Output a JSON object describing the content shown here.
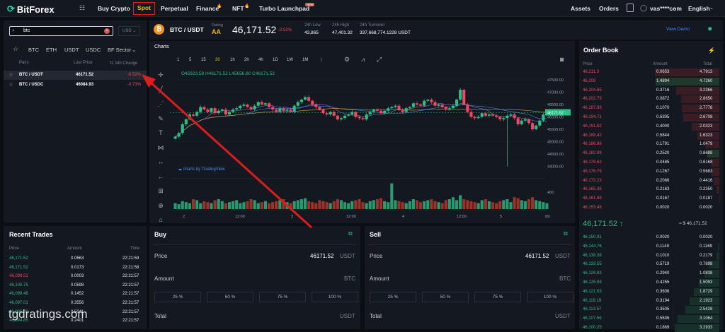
{
  "nav": {
    "logo": "BitForex",
    "items": [
      "Buy Crypto",
      "Spot",
      "Perpetual",
      "Finance",
      "NFT",
      "Turbo Launchpad"
    ],
    "new_badge": "NEW",
    "assets": "Assets",
    "orders": "Orders",
    "account": "vas****com",
    "language": "English"
  },
  "market": {
    "search_value": "btc",
    "currency": "USD",
    "tabs": [
      "BTC",
      "ETH",
      "USDT",
      "USDC",
      "BF Sector"
    ],
    "headers": [
      "Pairs",
      "Last Price",
      "24h Change"
    ],
    "rows": [
      {
        "pair": "BTC / USDT",
        "price": "46171.52",
        "change": "-0.52%"
      },
      {
        "pair": "BTC / USDC",
        "price": "46084.93",
        "change": "-0.73%"
      }
    ]
  },
  "ticker": {
    "pair": "BTC / USDT",
    "rating_label": "Rating",
    "rating": "AA",
    "price": "46,171.52",
    "change": "-0.52%",
    "low_label": "24h Low",
    "low": "43,865",
    "high_label": "24h High",
    "high": "47,401.32",
    "turnover_label": "24h Turnover",
    "turnover": "337,668,774.1228 USDT",
    "view_demo": "View Demo"
  },
  "chart": {
    "title": "Charts",
    "timeframes": [
      "1",
      "5",
      "15",
      "30",
      "1h",
      "2h",
      "4h",
      "1D",
      "1W",
      "1M"
    ],
    "ohlc": {
      "o": "O45923.59",
      "h": "H46171.52",
      "l": "L45656.80",
      "c": "C46171.52"
    },
    "watermark": "charts by TradingView",
    "price_label": "46171.52",
    "y_ticks": [
      "47500.00",
      "47000.00",
      "46500.00",
      "46000.00",
      "45500.00",
      "45000.00",
      "44500.00",
      "44000.00"
    ],
    "vol_tick": "400",
    "x_ticks": [
      "2",
      "12:00",
      "3",
      "12:00",
      "4",
      "12:00",
      "5",
      "09:"
    ]
  },
  "chart_data": {
    "type": "candlestick",
    "ylim": [
      43700,
      47700
    ],
    "close": [
      45200,
      45350,
      45700,
      45900,
      46100,
      46050,
      46200,
      46400,
      46300,
      46200,
      46350,
      46150,
      46250,
      46300,
      46100,
      46200,
      46300,
      46350,
      46450,
      46500,
      46400,
      46300,
      46450,
      46600,
      46500,
      46550,
      46400,
      46300,
      46200,
      46350,
      46250,
      46300,
      46200,
      46450,
      46600,
      46700,
      46800,
      46650,
      46500,
      46400,
      46300,
      46150,
      46100,
      46200,
      46050,
      45900,
      45950,
      46050,
      46100,
      46200,
      46000,
      45950,
      45900,
      46100,
      46200,
      46300,
      46250,
      46150,
      46250,
      46350,
      46400,
      46450,
      46300,
      46200,
      46350,
      46400,
      46550,
      46500,
      46450,
      46650,
      46700,
      46600,
      46450,
      46500,
      46400,
      46300,
      46350,
      46450,
      46700,
      47100,
      46500,
      46200,
      46000,
      45950,
      46000,
      46150,
      46050,
      46100,
      46050,
      46000,
      45900,
      45950,
      46050,
      46100,
      45950,
      45700,
      45850,
      45900,
      45750,
      45500,
      45650,
      45850,
      46100,
      46171
    ],
    "volume": [
      30,
      25,
      40,
      35,
      30,
      50,
      45,
      30,
      40,
      35,
      30,
      45,
      50,
      40,
      30,
      35,
      40,
      45,
      30,
      35,
      40,
      50,
      45,
      30,
      35,
      40,
      30,
      35,
      40,
      45,
      50,
      35,
      30,
      40,
      45,
      50,
      55,
      40,
      35,
      30,
      45,
      40,
      35,
      30,
      40,
      50,
      45,
      35,
      30,
      40,
      45,
      50,
      35,
      30,
      40,
      45,
      50,
      55,
      40,
      35,
      130,
      45,
      40,
      35,
      30,
      40,
      50,
      45,
      35,
      40,
      45,
      50,
      40,
      35,
      30,
      45,
      50,
      60,
      45,
      70,
      50,
      45,
      40,
      35,
      30,
      45,
      50,
      40,
      35,
      30,
      40,
      45,
      50,
      35,
      60,
      55,
      45,
      40,
      50,
      60,
      45,
      40,
      35,
      30
    ]
  },
  "order_book": {
    "title": "Order Book",
    "headers": [
      "Price",
      "Amount",
      "Total"
    ],
    "asks": [
      [
        "46,211.3",
        "0.0653",
        "4.7913"
      ],
      [
        "46,208",
        "1.4894",
        "4.7260"
      ],
      [
        "46,204.65",
        "0.3716",
        "3.2366"
      ],
      [
        "46,202.79",
        "0.0872",
        "2.8650"
      ],
      [
        "46,197.93",
        "0.1070",
        "2.7778"
      ],
      [
        "46,194.71",
        "0.6305",
        "2.6708"
      ],
      [
        "46,191.62",
        "0.4000",
        "2.0323"
      ],
      [
        "46,188.42",
        "0.5844",
        "1.6323"
      ],
      [
        "46,186.86",
        "0.1791",
        "1.0479"
      ],
      [
        "46,182.99",
        "0.2520",
        "0.8688"
      ],
      [
        "46,179.62",
        "0.0485",
        "0.6168"
      ],
      [
        "46,176.76",
        "0.1267",
        "0.5683"
      ],
      [
        "46,173.23",
        "0.2066",
        "0.4416"
      ],
      [
        "46,165.36",
        "0.2163",
        "0.2350"
      ],
      [
        "46,161.68",
        "0.0167",
        "0.0187"
      ],
      [
        "46,153.48",
        "0.0020",
        "0.0020"
      ]
    ],
    "last": "46,171.52",
    "last_usd": "≈ $ 46,171.52",
    "bids": [
      [
        "46,150.91",
        "0.0020",
        "0.0020"
      ],
      [
        "46,144.76",
        "0.1149",
        "0.1169"
      ],
      [
        "46,138.38",
        "0.1010",
        "0.2179"
      ],
      [
        "46,133.55",
        "0.5719",
        "0.7898"
      ],
      [
        "46,128.83",
        "0.2940",
        "1.0838"
      ],
      [
        "46,125.59",
        "0.4255",
        "1.5093"
      ],
      [
        "46,121.63",
        "0.3636",
        "1.8729"
      ],
      [
        "46,118.19",
        "0.3194",
        "2.1923"
      ],
      [
        "46,113.57",
        "0.3505",
        "2.5428"
      ],
      [
        "46,107.56",
        "0.5636",
        "3.1064"
      ],
      [
        "46,100.25",
        "0.1869",
        "3.2933"
      ]
    ]
  },
  "recent": {
    "title": "Recent Trades",
    "headers": [
      "Price",
      "Amount",
      "Time"
    ],
    "rows": [
      [
        "46,171.52",
        "0.0663",
        "22:21:59",
        "g"
      ],
      [
        "46,171.52",
        "0.0173",
        "22:21:58",
        "g"
      ],
      [
        "46,099.51",
        "0.0003",
        "22:21:57",
        "r"
      ],
      [
        "46,100.75",
        "0.0598",
        "22:21:57",
        "g"
      ],
      [
        "46,099.48",
        "0.1452",
        "22:21:57",
        "g"
      ],
      [
        "46,097.01",
        "0.3556",
        "22:21:57",
        "g"
      ],
      [
        "46,095.09",
        "0.5041",
        "22:21:57",
        "g"
      ],
      [
        "46,094.85",
        "0.2401",
        "22:21:57",
        "g"
      ]
    ]
  },
  "buy": {
    "title": "Buy",
    "price_label": "Price",
    "price": "46171.52",
    "unit": "USDT",
    "amount_label": "Amount",
    "amount_unit": "BTC",
    "pcts": [
      "25 %",
      "50 %",
      "75 %",
      "100 %"
    ],
    "total_label": "Total",
    "total_unit": "USDT"
  },
  "sell": {
    "title": "Sell",
    "price_label": "Price",
    "price": "46171.52",
    "unit": "USDT",
    "amount_label": "Amount",
    "amount_unit": "BTC",
    "pcts": [
      "25 %",
      "50 %",
      "75 %",
      "100 %"
    ],
    "total_label": "Total",
    "total_unit": "USDT"
  },
  "watermark": "tgdratings.com"
}
